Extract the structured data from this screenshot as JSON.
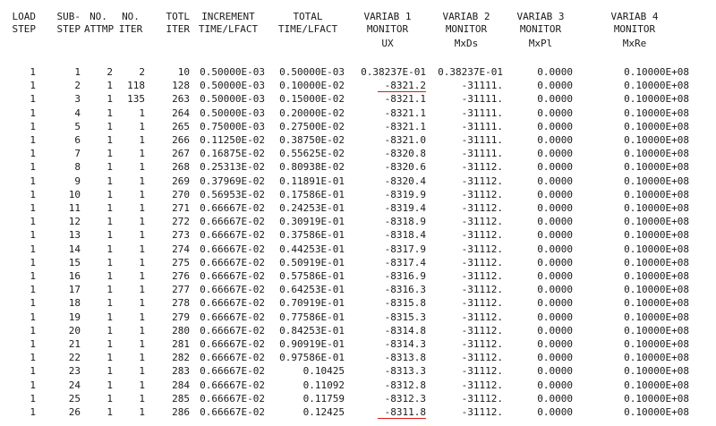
{
  "headers": {
    "line1": [
      "LOAD",
      "SUB-",
      "NO.",
      "NO.",
      "TOTL",
      "INCREMENT",
      "TOTAL",
      "VARIAB 1",
      "VARIAB 2",
      "VARIAB 3",
      "VARIAB 4"
    ],
    "line2": [
      "STEP",
      "STEP",
      "ATTMP",
      "ITER",
      "ITER",
      "TIME/LFACT",
      "TIME/LFACT",
      "MONITOR",
      "MONITOR",
      "MONITOR",
      "MONITOR"
    ],
    "line3": [
      "",
      "",
      "",
      "",
      "",
      "",
      "",
      "UX",
      "MxDs",
      "MxPl",
      "MxRe"
    ]
  },
  "rows": [
    [
      "1",
      "1",
      "2",
      "2",
      "10",
      "0.50000E-03",
      "0.50000E-03",
      "0.38237E-01",
      "0.38237E-01",
      "0.0000",
      "0.10000E+08"
    ],
    [
      "1",
      "2",
      "1",
      "118",
      "128",
      "0.50000E-03",
      "0.10000E-02",
      "-8321.2",
      "-31111.",
      "0.0000",
      "0.10000E+08"
    ],
    [
      "1",
      "3",
      "1",
      "135",
      "263",
      "0.50000E-03",
      "0.15000E-02",
      "-8321.1",
      "-31111.",
      "0.0000",
      "0.10000E+08"
    ],
    [
      "1",
      "4",
      "1",
      "1",
      "264",
      "0.50000E-03",
      "0.20000E-02",
      "-8321.1",
      "-31111.",
      "0.0000",
      "0.10000E+08"
    ],
    [
      "1",
      "5",
      "1",
      "1",
      "265",
      "0.75000E-03",
      "0.27500E-02",
      "-8321.1",
      "-31111.",
      "0.0000",
      "0.10000E+08"
    ],
    [
      "1",
      "6",
      "1",
      "1",
      "266",
      "0.11250E-02",
      "0.38750E-02",
      "-8321.0",
      "-31111.",
      "0.0000",
      "0.10000E+08"
    ],
    [
      "1",
      "7",
      "1",
      "1",
      "267",
      "0.16875E-02",
      "0.55625E-02",
      "-8320.8",
      "-31111.",
      "0.0000",
      "0.10000E+08"
    ],
    [
      "1",
      "8",
      "1",
      "1",
      "268",
      "0.25313E-02",
      "0.80938E-02",
      "-8320.6",
      "-31112.",
      "0.0000",
      "0.10000E+08"
    ],
    [
      "1",
      "9",
      "1",
      "1",
      "269",
      "0.37969E-02",
      "0.11891E-01",
      "-8320.4",
      "-31112.",
      "0.0000",
      "0.10000E+08"
    ],
    [
      "1",
      "10",
      "1",
      "1",
      "270",
      "0.56953E-02",
      "0.17586E-01",
      "-8319.9",
      "-31112.",
      "0.0000",
      "0.10000E+08"
    ],
    [
      "1",
      "11",
      "1",
      "1",
      "271",
      "0.66667E-02",
      "0.24253E-01",
      "-8319.4",
      "-31112.",
      "0.0000",
      "0.10000E+08"
    ],
    [
      "1",
      "12",
      "1",
      "1",
      "272",
      "0.66667E-02",
      "0.30919E-01",
      "-8318.9",
      "-31112.",
      "0.0000",
      "0.10000E+08"
    ],
    [
      "1",
      "13",
      "1",
      "1",
      "273",
      "0.66667E-02",
      "0.37586E-01",
      "-8318.4",
      "-31112.",
      "0.0000",
      "0.10000E+08"
    ],
    [
      "1",
      "14",
      "1",
      "1",
      "274",
      "0.66667E-02",
      "0.44253E-01",
      "-8317.9",
      "-31112.",
      "0.0000",
      "0.10000E+08"
    ],
    [
      "1",
      "15",
      "1",
      "1",
      "275",
      "0.66667E-02",
      "0.50919E-01",
      "-8317.4",
      "-31112.",
      "0.0000",
      "0.10000E+08"
    ],
    [
      "1",
      "16",
      "1",
      "1",
      "276",
      "0.66667E-02",
      "0.57586E-01",
      "-8316.9",
      "-31112.",
      "0.0000",
      "0.10000E+08"
    ],
    [
      "1",
      "17",
      "1",
      "1",
      "277",
      "0.66667E-02",
      "0.64253E-01",
      "-8316.3",
      "-31112.",
      "0.0000",
      "0.10000E+08"
    ],
    [
      "1",
      "18",
      "1",
      "1",
      "278",
      "0.66667E-02",
      "0.70919E-01",
      "-8315.8",
      "-31112.",
      "0.0000",
      "0.10000E+08"
    ],
    [
      "1",
      "19",
      "1",
      "1",
      "279",
      "0.66667E-02",
      "0.77586E-01",
      "-8315.3",
      "-31112.",
      "0.0000",
      "0.10000E+08"
    ],
    [
      "1",
      "20",
      "1",
      "1",
      "280",
      "0.66667E-02",
      "0.84253E-01",
      "-8314.8",
      "-31112.",
      "0.0000",
      "0.10000E+08"
    ],
    [
      "1",
      "21",
      "1",
      "1",
      "281",
      "0.66667E-02",
      "0.90919E-01",
      "-8314.3",
      "-31112.",
      "0.0000",
      "0.10000E+08"
    ],
    [
      "1",
      "22",
      "1",
      "1",
      "282",
      "0.66667E-02",
      "0.97586E-01",
      "-8313.8",
      "-31112.",
      "0.0000",
      "0.10000E+08"
    ],
    [
      "1",
      "23",
      "1",
      "1",
      "283",
      "0.66667E-02",
      "0.10425",
      "-8313.3",
      "-31112.",
      "0.0000",
      "0.10000E+08"
    ],
    [
      "1",
      "24",
      "1",
      "1",
      "284",
      "0.66667E-02",
      "0.11092",
      "-8312.8",
      "-31112.",
      "0.0000",
      "0.10000E+08"
    ],
    [
      "1",
      "25",
      "1",
      "1",
      "285",
      "0.66667E-02",
      "0.11759",
      "-8312.3",
      "-31112.",
      "0.0000",
      "0.10000E+08"
    ],
    [
      "1",
      "26",
      "1",
      "1",
      "286",
      "0.66667E-02",
      "0.12425",
      "-8311.8",
      "-31112.",
      "0.0000",
      "0.10000E+08"
    ]
  ],
  "highlighted_cells": [
    {
      "row": 1,
      "column": 7,
      "value": "-8321.2"
    },
    {
      "row": 25,
      "column": 7,
      "value": "-8311.8"
    }
  ],
  "colors": {
    "text": "#1a1a1a",
    "background": "#ffffff",
    "annotation_underline": "#d81b1b"
  }
}
